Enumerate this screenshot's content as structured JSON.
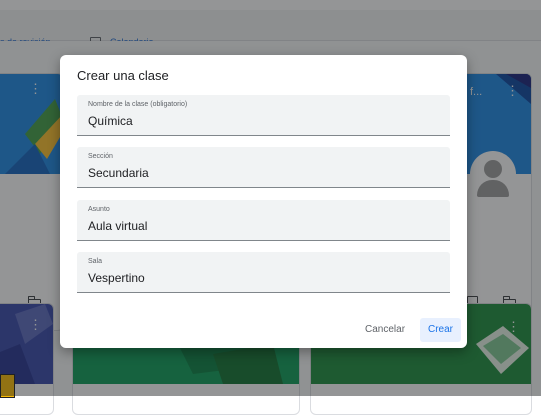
{
  "background": {
    "nav": {
      "revision_label": "s de revisión",
      "calendar_label": "Calendario"
    },
    "cards": {
      "top_right_title": "f..."
    }
  },
  "dialog": {
    "title": "Crear una clase",
    "fields": [
      {
        "label": "Nombre de la clase (obligatorio)",
        "value": "Química"
      },
      {
        "label": "Sección",
        "value": "Secundaria"
      },
      {
        "label": "Asunto",
        "value": "Aula virtual"
      },
      {
        "label": "Sala",
        "value": "Vespertino"
      }
    ],
    "cancel_label": "Cancelar",
    "create_label": "Crear"
  }
}
